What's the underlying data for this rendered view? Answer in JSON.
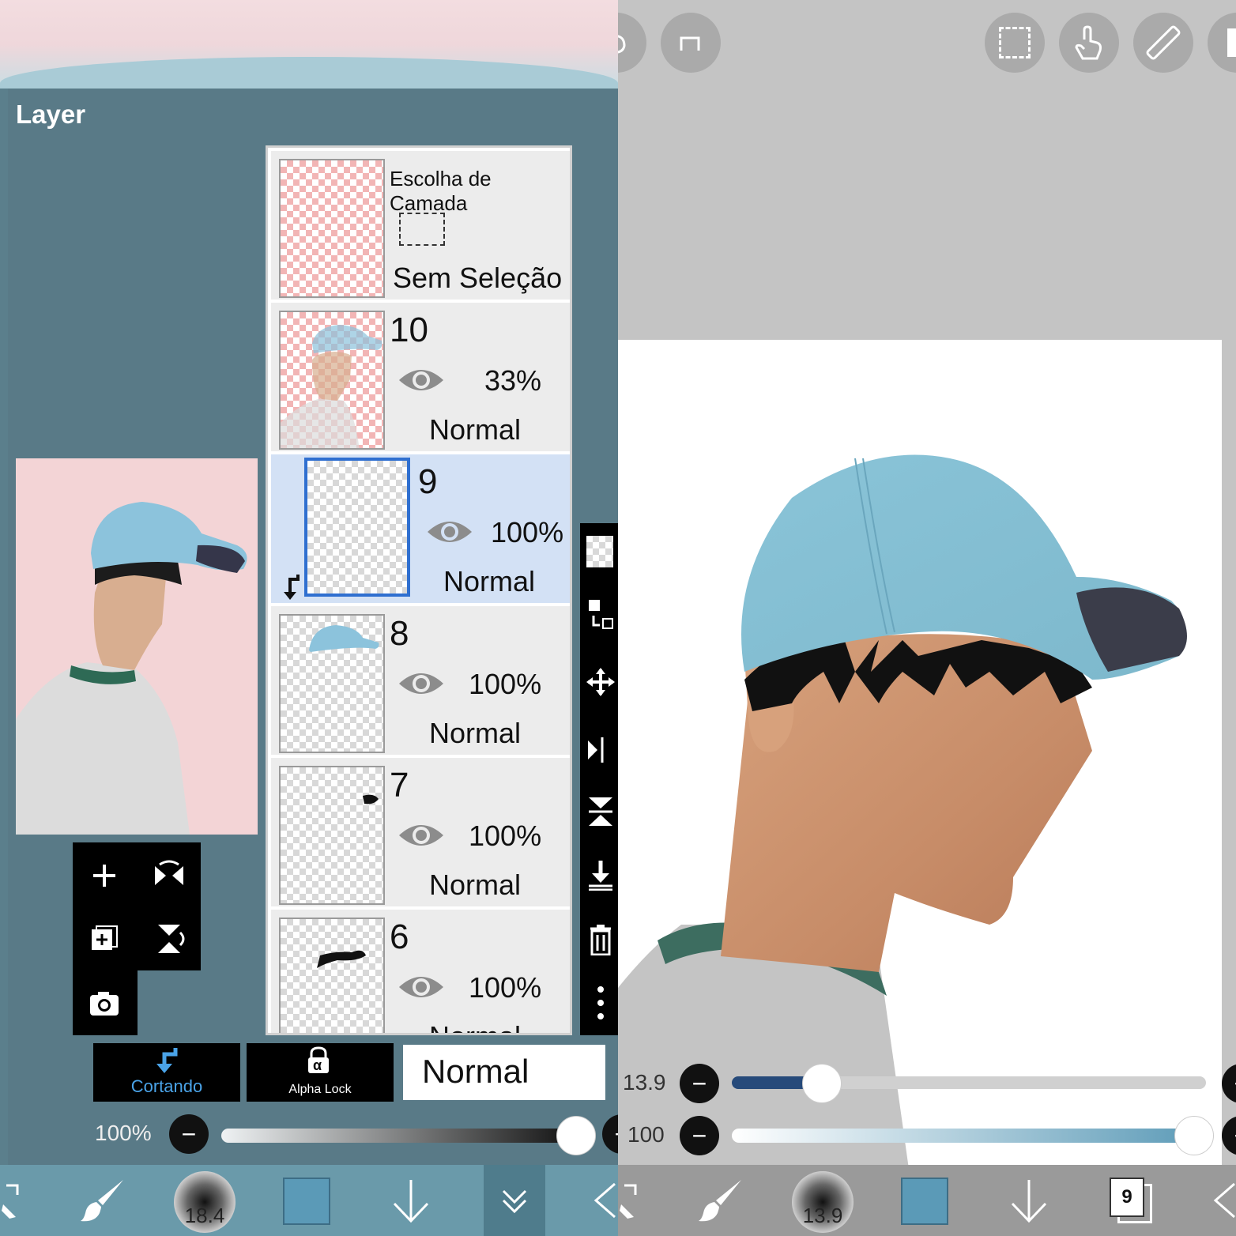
{
  "left": {
    "panel_title": "Layer",
    "selection_layer": {
      "title": "Escolha de Camada",
      "status": "Sem Seleção"
    },
    "layers": [
      {
        "number": "10",
        "opacity": "33%",
        "mode": "Normal",
        "visible": true,
        "selected": false
      },
      {
        "number": "9",
        "opacity": "100%",
        "mode": "Normal",
        "visible": true,
        "selected": true,
        "clipping": true
      },
      {
        "number": "8",
        "opacity": "100%",
        "mode": "Normal",
        "visible": true,
        "selected": false
      },
      {
        "number": "7",
        "opacity": "100%",
        "mode": "Normal",
        "visible": true,
        "selected": false
      },
      {
        "number": "6",
        "opacity": "100%",
        "mode": "Normal",
        "visible": true,
        "selected": false
      }
    ],
    "clipping_label": "Cortando",
    "alpha_lock_label": "Alpha Lock",
    "alpha_symbol": "α",
    "blend_mode": "Normal",
    "layer_opacity": "100%",
    "brush_size": "18.4",
    "accent_color": "#2f6fd0",
    "cortando_color": "#4aa3e8"
  },
  "right": {
    "brush_size_value": "13.9",
    "brush_opacity_value": "100",
    "brush_size_fraction": 0.19,
    "brush_opacity_fraction": 1.0,
    "bottom_brush_size": "13.9",
    "layer_count_badge": "9",
    "current_color": "#5b9ab7",
    "top_icons": [
      "undo-icon",
      "redo-icon",
      "selection-icon",
      "touch-icon",
      "ruler-icon",
      "reference-icon"
    ]
  }
}
